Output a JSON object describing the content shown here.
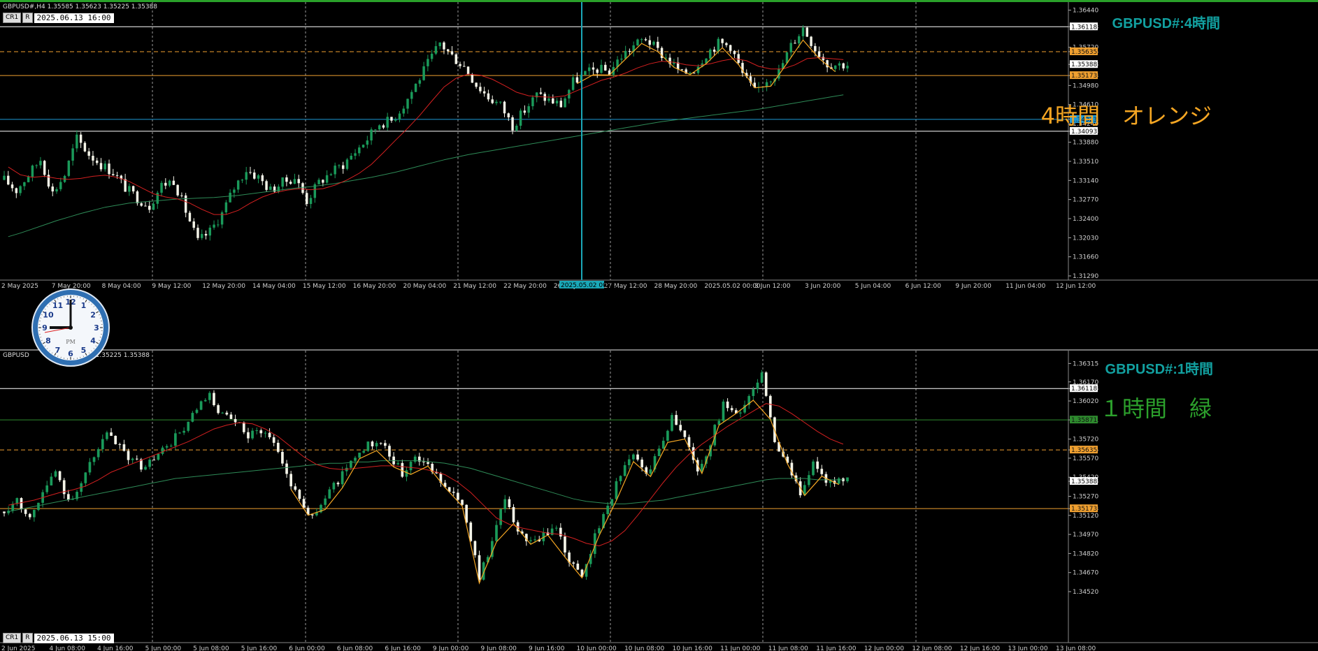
{
  "colors": {
    "bull": "#1a9a5a",
    "bear": "#f4f4e8",
    "ma_fast": "#d42020",
    "ma_slow": "#2e8b57",
    "zigzag": "#f5a623",
    "orange_line": "#f0a030",
    "blue_line": "#1e9ad6",
    "white_line": "#ffffff",
    "green_line": "#2e8b2e",
    "title_teal": "#12a0a0",
    "label_orange": "#f5a623",
    "label_green": "#2ca02c",
    "top_bar": "#2aa02a"
  },
  "top_pane": {
    "header": "GBPUSD#,H4  1.35585 1.35623 1.35225 1.35388",
    "title": "GBPUSD#:4時間",
    "label": "4時間　オレンジ",
    "date_box": "2025.06.13 16:00",
    "btn_cr": "CR1",
    "btn_r": "R",
    "cursor_label": "2025.05.02 00:00"
  },
  "bottom_pane": {
    "header": "GBPUSD",
    "header_values": "1.35225 1.35388",
    "title": "GBPUSD#:1時間",
    "label": "１時間　緑",
    "date_box": "2025.06.13 15:00",
    "btn_cr": "CR1",
    "btn_r": "R"
  },
  "clock": {
    "numbers": [
      "12",
      "1",
      "2",
      "3",
      "4",
      "5",
      "6",
      "7",
      "8",
      "9",
      "10",
      "11"
    ],
    "ampm": "PM"
  },
  "chart_data": [
    {
      "type": "candlestick",
      "title": "GBPUSD#:4時間",
      "symbol": "GBPUSD#",
      "timeframe": "H4",
      "ohlc_last": {
        "open": 1.35585,
        "high": 1.35623,
        "low": 1.35225,
        "close": 1.35388
      },
      "ylim": [
        1.3129,
        1.3646
      ],
      "y_ticks": [
        "1.36440",
        "1.36118",
        "1.35720",
        "1.35635",
        "1.35388",
        "1.35173",
        "1.34980",
        "1.34610",
        "1.34323",
        "1.34240",
        "1.34093",
        "1.33880",
        "1.33510",
        "1.33140",
        "1.32770",
        "1.32400",
        "1.32030",
        "1.31660",
        "1.31290"
      ],
      "x_tick_labels": [
        "2 May 2025",
        "7 May 20:00",
        "8 May 04:00",
        "9 May 12:00",
        "12 May 20:00",
        "14 May 04:00",
        "15 May 12:00",
        "16 May 20:00",
        "20 May 04:00",
        "21 May 12:00",
        "22 May 20:00",
        "26 May 04:00",
        "27 May 12:00",
        "28 May 20:00",
        "2025.05.02 00:00",
        "3 Jun 12:00",
        "3 Jun 20:00",
        "5 Jun 04:00",
        "6 Jun 12:00",
        "9 Jun 20:00",
        "11 Jun 04:00",
        "12 Jun 12:00"
      ],
      "horizontal_lines": [
        {
          "price": 1.36118,
          "label": "1.36118",
          "color": "white",
          "style": "solid"
        },
        {
          "price": 1.35635,
          "label": "1.35635",
          "color": "orange",
          "style": "dashed"
        },
        {
          "price": 1.35388,
          "label": "1.35388",
          "color": "white",
          "style": "price"
        },
        {
          "price": 1.35173,
          "label": "1.35173",
          "color": "orange",
          "style": "solid"
        },
        {
          "price": 1.34323,
          "label": "1.34323",
          "color": "blue",
          "style": "solid"
        },
        {
          "price": 1.34093,
          "label": "1.34093",
          "color": "white",
          "style": "solid"
        }
      ],
      "series": [
        {
          "name": "close_path",
          "values": [
            1.3315,
            1.3295,
            1.3325,
            1.3355,
            1.329,
            1.3325,
            1.3395,
            1.3365,
            1.3345,
            1.333,
            1.33,
            1.328,
            1.3265,
            1.3305,
            1.3315,
            1.3255,
            1.3195,
            1.3215,
            1.325,
            1.33,
            1.3335,
            1.332,
            1.3295,
            1.331,
            1.332,
            1.3275,
            1.331,
            1.333,
            1.3345,
            1.337,
            1.3395,
            1.3425,
            1.343,
            1.346,
            1.35,
            1.354,
            1.358,
            1.3555,
            1.3535,
            1.35,
            1.3475,
            1.346,
            1.342,
            1.345,
            1.348,
            1.347,
            1.346,
            1.3505,
            1.352,
            1.353,
            1.3525,
            1.3555,
            1.3575,
            1.359,
            1.3565,
            1.3545,
            1.352,
            1.353,
            1.356,
            1.358,
            1.3575,
            1.352,
            1.3485,
            1.351,
            1.3525,
            1.3575,
            1.361,
            1.357,
            1.354,
            1.3539
          ]
        },
        {
          "name": "ma_fast",
          "values": [
            1.334,
            1.3325,
            1.332,
            1.3322,
            1.3318,
            1.3316,
            1.3318,
            1.3322,
            1.3324,
            1.332,
            1.3312,
            1.33,
            1.3288,
            1.3282,
            1.3278,
            1.327,
            1.3258,
            1.3248,
            1.3248,
            1.3256,
            1.327,
            1.3282,
            1.329,
            1.3295,
            1.3298,
            1.3296,
            1.3298,
            1.3305,
            1.3315,
            1.3328,
            1.3345,
            1.3368,
            1.3392,
            1.3415,
            1.344,
            1.3468,
            1.3495,
            1.3512,
            1.352,
            1.3518,
            1.351,
            1.3498,
            1.3485,
            1.3478,
            1.3476,
            1.3475,
            1.3478,
            1.3488,
            1.3498,
            1.3508,
            1.3514,
            1.3522,
            1.3532,
            1.354,
            1.3545,
            1.3543,
            1.3538,
            1.3536,
            1.354,
            1.3546,
            1.355,
            1.3546,
            1.3535,
            1.353,
            1.353,
            1.3538,
            1.355,
            1.3552,
            1.355,
            1.3548
          ]
        },
        {
          "name": "ma_slow",
          "values": [
            1.3205,
            1.3212,
            1.322,
            1.3228,
            1.3236,
            1.3243,
            1.325,
            1.3256,
            1.3262,
            1.3266,
            1.327,
            1.3272,
            1.3274,
            1.3276,
            1.3278,
            1.3279,
            1.328,
            1.3281,
            1.3283,
            1.3285,
            1.3288,
            1.3291,
            1.3294,
            1.3297,
            1.33,
            1.3302,
            1.3305,
            1.3308,
            1.3312,
            1.3316,
            1.332,
            1.3325,
            1.333,
            1.3336,
            1.3342,
            1.3348,
            1.3354,
            1.3359,
            1.3364,
            1.3368,
            1.3372,
            1.3376,
            1.338,
            1.3384,
            1.3388,
            1.3392,
            1.3396,
            1.34,
            1.3404,
            1.3408,
            1.3412,
            1.3416,
            1.342,
            1.3424,
            1.3428,
            1.3431,
            1.3434,
            1.3437,
            1.344,
            1.3443,
            1.3446,
            1.3449,
            1.3452,
            1.3456,
            1.346,
            1.3464,
            1.3468,
            1.3472,
            1.3476,
            1.348
          ]
        }
      ]
    },
    {
      "type": "candlestick",
      "title": "GBPUSD#:1時間",
      "symbol": "GBPUSD#",
      "timeframe": "H1",
      "ylim": [
        1.3452,
        1.3635
      ],
      "y_ticks": [
        "1.36315",
        "1.36170",
        "1.36118",
        "1.36020",
        "1.35871",
        "1.35720",
        "1.35635",
        "1.35570",
        "1.35420",
        "1.35388",
        "1.35270",
        "1.35173",
        "1.35120",
        "1.34970",
        "1.34820",
        "1.34670",
        "1.34520"
      ],
      "x_tick_labels": [
        "2 Jun 2025",
        "4 Jun 08:00",
        "4 Jun 16:00",
        "5 Jun 00:00",
        "5 Jun 08:00",
        "5 Jun 16:00",
        "6 Jun 00:00",
        "6 Jun 08:00",
        "6 Jun 16:00",
        "9 Jun 00:00",
        "9 Jun 08:00",
        "9 Jun 16:00",
        "10 Jun 00:00",
        "10 Jun 08:00",
        "10 Jun 16:00",
        "11 Jun 00:00",
        "11 Jun 08:00",
        "11 Jun 16:00",
        "12 Jun 00:00",
        "12 Jun 08:00",
        "12 Jun 16:00",
        "13 Jun 00:00",
        "13 Jun 08:00"
      ],
      "horizontal_lines": [
        {
          "price": 1.36118,
          "label": "1.36118",
          "color": "white",
          "style": "solid"
        },
        {
          "price": 1.35871,
          "label": "1.35871",
          "color": "green",
          "style": "solid"
        },
        {
          "price": 1.35635,
          "label": "1.35635",
          "color": "orange",
          "style": "dashed"
        },
        {
          "price": 1.35388,
          "label": "1.35388",
          "color": "white",
          "style": "price"
        },
        {
          "price": 1.35173,
          "label": "1.35173",
          "color": "orange",
          "style": "solid"
        }
      ],
      "series": [
        {
          "name": "close_path",
          "values": [
            1.3515,
            1.3525,
            1.351,
            1.353,
            1.3545,
            1.3525,
            1.3535,
            1.356,
            1.3575,
            1.3565,
            1.3555,
            1.355,
            1.356,
            1.357,
            1.358,
            1.3595,
            1.3605,
            1.359,
            1.3585,
            1.3575,
            1.358,
            1.357,
            1.3545,
            1.3525,
            1.351,
            1.3525,
            1.354,
            1.3555,
            1.3565,
            1.357,
            1.356,
            1.3545,
            1.356,
            1.355,
            1.354,
            1.353,
            1.351,
            1.3465,
            1.349,
            1.3525,
            1.35,
            1.349,
            1.3495,
            1.3505,
            1.3475,
            1.3465,
            1.3495,
            1.352,
            1.3545,
            1.356,
            1.3545,
            1.3565,
            1.359,
            1.3575,
            1.3545,
            1.357,
            1.36,
            1.359,
            1.3605,
            1.3625,
            1.357,
            1.355,
            1.353,
            1.3555,
            1.3535,
            1.3539
          ]
        },
        {
          "name": "ma_fast",
          "values": [
            1.352,
            1.3522,
            1.3524,
            1.3527,
            1.353,
            1.3532,
            1.3535,
            1.354,
            1.3546,
            1.355,
            1.3554,
            1.3558,
            1.3562,
            1.3566,
            1.357,
            1.3575,
            1.358,
            1.3583,
            1.3585,
            1.3584,
            1.358,
            1.3574,
            1.3566,
            1.3558,
            1.3552,
            1.3549,
            1.3548,
            1.3549,
            1.355,
            1.3551,
            1.3551,
            1.355,
            1.3549,
            1.3547,
            1.3544,
            1.3538,
            1.353,
            1.352,
            1.351,
            1.3505,
            1.3502,
            1.35,
            1.3498,
            1.3497,
            1.3494,
            1.349,
            1.3488,
            1.3492,
            1.35,
            1.3512,
            1.3525,
            1.3538,
            1.355,
            1.356,
            1.3568,
            1.3575,
            1.3582,
            1.3588,
            1.3594,
            1.36,
            1.3598,
            1.3592,
            1.3585,
            1.3578,
            1.3572,
            1.3568
          ]
        },
        {
          "name": "ma_slow",
          "values": [
            1.3515,
            1.3517,
            1.3519,
            1.3521,
            1.3523,
            1.3525,
            1.3527,
            1.3529,
            1.3531,
            1.3533,
            1.3535,
            1.3537,
            1.3539,
            1.3541,
            1.3542,
            1.3543,
            1.3544,
            1.3545,
            1.3546,
            1.3547,
            1.3548,
            1.3549,
            1.355,
            1.3551,
            1.3552,
            1.3553,
            1.3553,
            1.3554,
            1.3554,
            1.3555,
            1.3555,
            1.3555,
            1.3555,
            1.3554,
            1.3553,
            1.3551,
            1.3549,
            1.3546,
            1.3543,
            1.354,
            1.3537,
            1.3534,
            1.3531,
            1.3528,
            1.3525,
            1.3523,
            1.3522,
            1.3521,
            1.3521,
            1.3522,
            1.3523,
            1.3524,
            1.3526,
            1.3528,
            1.353,
            1.3532,
            1.3534,
            1.3536,
            1.3538,
            1.354,
            1.3541,
            1.3541,
            1.3541,
            1.354,
            1.354,
            1.354
          ]
        }
      ]
    }
  ]
}
